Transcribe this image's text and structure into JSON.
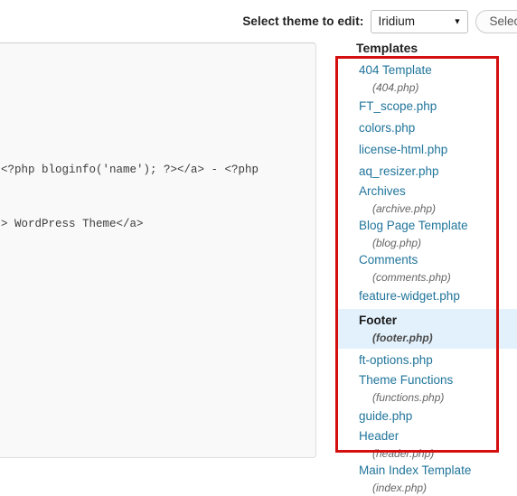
{
  "theme_bar": {
    "label": "Select theme to edit:",
    "selected_theme": "Iridium",
    "caret_icon": "chevron-down-icon",
    "button_label": "Select"
  },
  "editor": {
    "code": "<?php bloginfo('name'); ?></a> - <?php\n\n> WordPress Theme</a>"
  },
  "templates": {
    "heading": "Templates",
    "highlight_color": "#e3f1fc",
    "link_color": "#21759b",
    "annotation_box_color": "#d40f0f",
    "items": [
      {
        "title": "404 Template",
        "file": "(404.php)",
        "active": false
      },
      {
        "title": "FT_scope.php",
        "file": "",
        "active": false
      },
      {
        "title": "colors.php",
        "file": "",
        "active": false
      },
      {
        "title": "license-html.php",
        "file": "",
        "active": false
      },
      {
        "title": "aq_resizer.php",
        "file": "",
        "active": false
      },
      {
        "title": "Archives",
        "file": "(archive.php)",
        "active": false
      },
      {
        "title": "Blog Page Template",
        "file": "(blog.php)",
        "active": false
      },
      {
        "title": "Comments",
        "file": "(comments.php)",
        "active": false
      },
      {
        "title": "feature-widget.php",
        "file": "",
        "active": false
      },
      {
        "title": "Footer",
        "file": "(footer.php)",
        "active": true
      },
      {
        "title": "ft-options.php",
        "file": "",
        "active": false
      },
      {
        "title": "Theme Functions",
        "file": "(functions.php)",
        "active": false
      },
      {
        "title": "guide.php",
        "file": "",
        "active": false
      },
      {
        "title": "Header",
        "file": "(header.php)",
        "active": false
      },
      {
        "title": "Main Index Template",
        "file": "(index.php)",
        "active": false
      }
    ]
  }
}
